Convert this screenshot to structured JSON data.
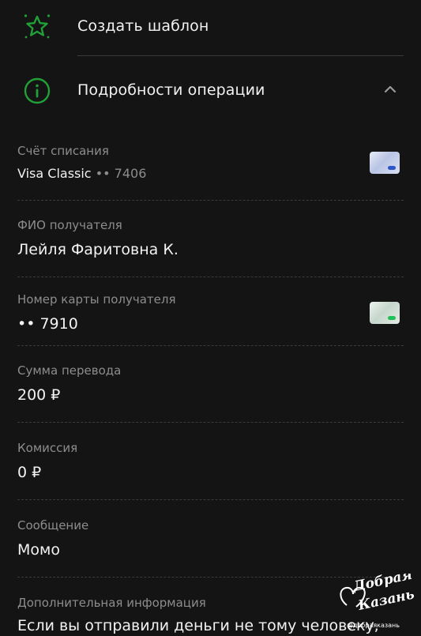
{
  "actions": {
    "create_template": {
      "label": "Создать шаблон",
      "icon": "star-icon"
    },
    "operation_details": {
      "label": "Подробности операции",
      "icon": "info-icon",
      "expanded": true
    }
  },
  "colors": {
    "accent_green": "#21a038",
    "amount_orange": "#f0632d",
    "background": "#141414"
  },
  "fields": {
    "debit_account": {
      "label": "Счёт списания",
      "card_name": "Visa Classic",
      "card_mask": "•• 7406"
    },
    "recipient_name": {
      "label": "ФИО получателя",
      "value": "Лейля Фаритовна К."
    },
    "recipient_card": {
      "label": "Номер карты получателя",
      "value": "•• 7910"
    },
    "amount": {
      "label": "Сумма перевода",
      "value": "200 ₽"
    },
    "commission": {
      "label": "Комиссия",
      "value": "0 ₽"
    },
    "message": {
      "label": "Сообщение",
      "value": "Момо"
    },
    "extra_info": {
      "label": "Дополнительная информация",
      "value": "Если вы отправили деньги не тому человеку,"
    }
  },
  "watermark": {
    "logo_text": "Добрая Казань",
    "handle": "@добраяказань"
  }
}
